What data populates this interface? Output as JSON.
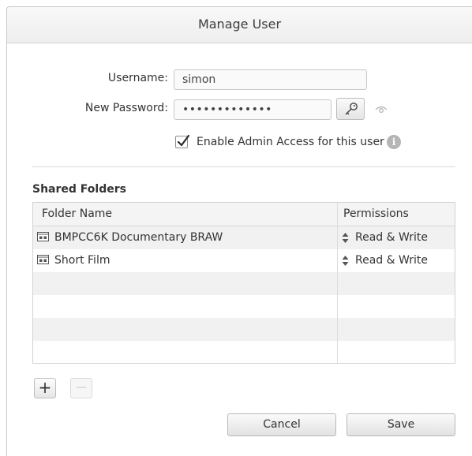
{
  "dialog": {
    "title": "Manage User"
  },
  "form": {
    "username_label": "Username:",
    "username_value": "simon",
    "password_label": "New Password:",
    "password_value": "•••••••••••••",
    "admin_checkbox_checked": true,
    "admin_checkbox_label": "Enable Admin Access for this user"
  },
  "shared_folders": {
    "title": "Shared Folders",
    "columns": [
      "Folder Name",
      "Permissions"
    ],
    "rows": [
      {
        "name": "BMPCC6K Documentary BRAW",
        "permission": "Read & Write"
      },
      {
        "name": "Short Film",
        "permission": "Read & Write"
      }
    ],
    "add_label": "+",
    "remove_label": "—"
  },
  "buttons": {
    "cancel": "Cancel",
    "save": "Save"
  },
  "icons": {
    "key": "key-icon",
    "eye": "eye-icon",
    "info": "info-icon",
    "folder": "shared-folder-icon",
    "spinner": "up-down-arrows-icon",
    "checkmark": "checkmark-icon"
  },
  "colors": {
    "title_bar": "#eeeeee",
    "alt_row": "#f1f1f1",
    "info_icon": "#b5b5b5"
  }
}
